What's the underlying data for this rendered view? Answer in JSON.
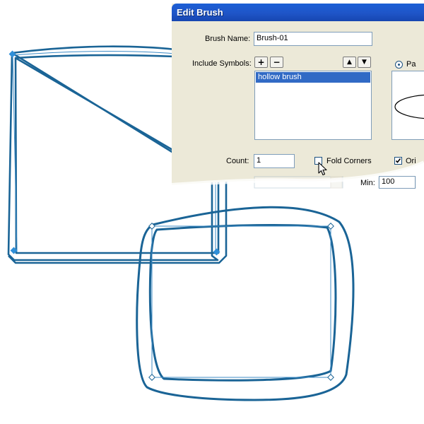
{
  "dialog": {
    "title": "Edit Brush",
    "brush_name_label": "Brush Name:",
    "brush_name_value": "Brush-01",
    "include_symbols_label": "Include Symbols:",
    "add_button": "+",
    "remove_button": "−",
    "up_button": "▲",
    "down_button": "▼",
    "symbols_list": [
      "hollow brush"
    ],
    "radio_label": "Pa",
    "count_label": "Count:",
    "count_value": "1",
    "fold_corners_label": "Fold Corners",
    "fold_corners_checked": false,
    "orient_label": "Ori",
    "orient_checked": true,
    "min_label": "Min:",
    "min_value": "100"
  },
  "colors": {
    "stroke": "#1a6496",
    "dialog_bg": "#ece9d8",
    "titlebar": "#1f55c8",
    "selection": "#316ac5",
    "node_fill": "#2f8fd8"
  },
  "icons": {
    "cursor": "arrow-cursor-icon",
    "node": "diamond-node-icon"
  }
}
